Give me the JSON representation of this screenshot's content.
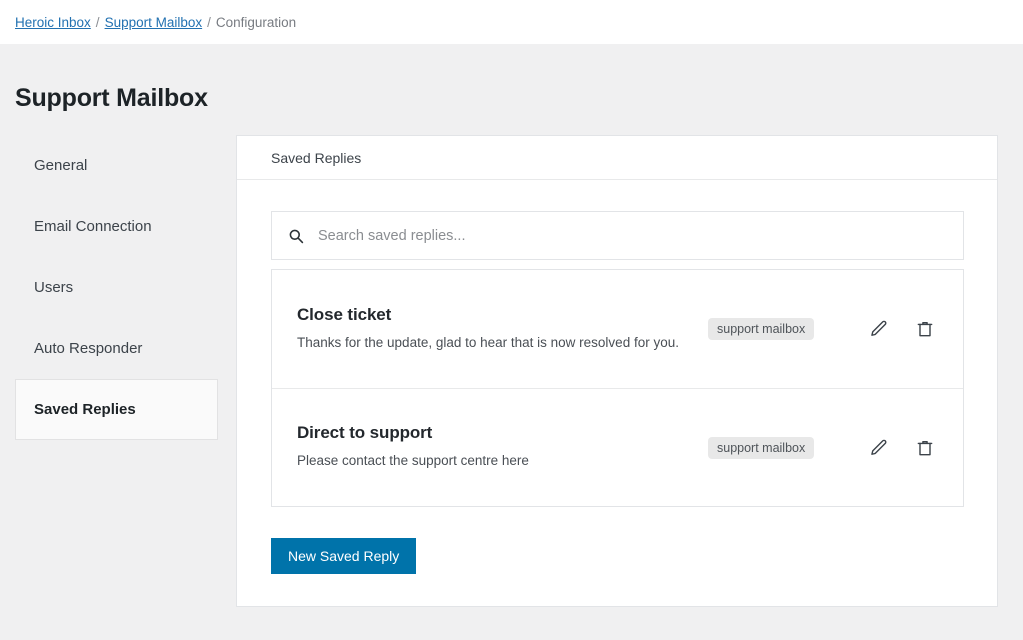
{
  "breadcrumb": {
    "items": [
      {
        "label": "Heroic Inbox",
        "type": "link"
      },
      {
        "label": "Support Mailbox",
        "type": "link"
      },
      {
        "label": "Configuration",
        "type": "current"
      }
    ],
    "separator": "/"
  },
  "page": {
    "title": "Support Mailbox"
  },
  "sidebar": {
    "items": [
      {
        "label": "General",
        "active": false
      },
      {
        "label": "Email Connection",
        "active": false
      },
      {
        "label": "Users",
        "active": false
      },
      {
        "label": "Auto Responder",
        "active": false
      },
      {
        "label": "Saved Replies",
        "active": true
      }
    ]
  },
  "card": {
    "header_title": "Saved Replies",
    "search": {
      "placeholder": "Search saved replies...",
      "value": "",
      "icon": "search-icon"
    },
    "replies": [
      {
        "title": "Close ticket",
        "description": "Thanks for the update, glad to hear that is now resolved for you.",
        "badge": "support mailbox",
        "edit_icon": "pencil-icon",
        "delete_icon": "trash-icon"
      },
      {
        "title": "Direct to support",
        "description": "Please contact the support centre here",
        "badge": "support mailbox",
        "edit_icon": "pencil-icon",
        "delete_icon": "trash-icon"
      }
    ],
    "new_button_label": "New Saved Reply"
  },
  "colors": {
    "primary_button": "#0073aa",
    "link": "#2271b1",
    "page_background": "#f0f0f1",
    "badge_background": "#e8e8e8"
  }
}
